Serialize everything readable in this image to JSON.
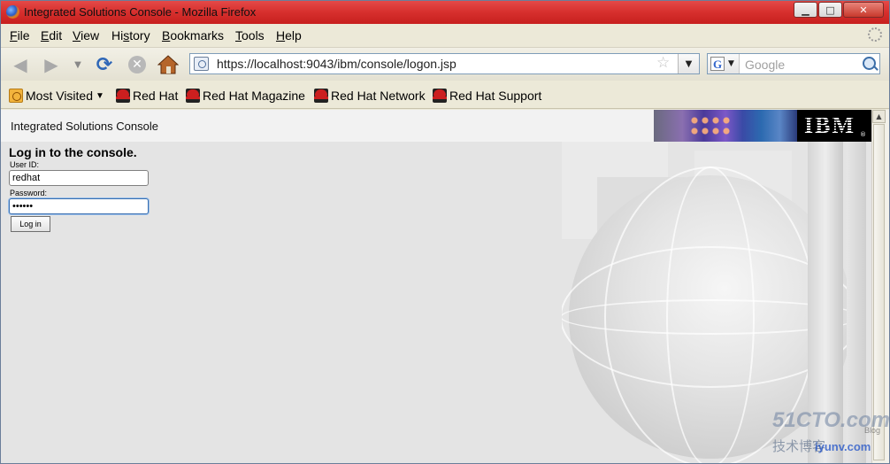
{
  "window": {
    "title": "Integrated Solutions Console - Mozilla Firefox",
    "controls": {
      "minimize": "▁",
      "maximize": "□",
      "close": "✕"
    }
  },
  "menu": [
    {
      "label": "File",
      "accel": "F",
      "rest": "ile"
    },
    {
      "label": "Edit",
      "accel": "E",
      "rest": "dit"
    },
    {
      "label": "View",
      "accel": "V",
      "rest": "iew"
    },
    {
      "label": "History",
      "accel": "",
      "pre": "Hi",
      "mid": "s",
      "rest": "tory"
    },
    {
      "label": "Bookmarks",
      "accel": "B",
      "rest": "ookmarks"
    },
    {
      "label": "Tools",
      "accel": "T",
      "rest": "ools"
    },
    {
      "label": "Help",
      "accel": "H",
      "rest": "elp"
    }
  ],
  "navigation": {
    "back_icon": "left-arrow-icon",
    "forward_icon": "right-arrow-icon",
    "reload_icon": "reload-icon",
    "stop_icon": "stop-icon",
    "home_icon": "home-icon",
    "url": "https://localhost:9043/ibm/console/logon.jsp",
    "search_placeholder": "Google",
    "search_engine_letter": "G"
  },
  "bookmarks": [
    {
      "label": "Most Visited",
      "icon": "folder-icon",
      "has_menu": true
    },
    {
      "label": "Red Hat",
      "icon": "redhat-icon"
    },
    {
      "label": "Red Hat Magazine",
      "icon": "redhat-icon"
    },
    {
      "label": "Red Hat Network",
      "icon": "redhat-icon"
    },
    {
      "label": "Red Hat Support",
      "icon": "redhat-icon"
    }
  ],
  "page": {
    "console_title": "Integrated Solutions Console",
    "brand": "IBM",
    "brand_mark": "®",
    "login": {
      "heading": "Log in to the console.",
      "user_id_label": "User ID:",
      "user_id_value": "redhat",
      "password_label": "Password:",
      "password_value": "••••••",
      "login_button": "Log in"
    }
  },
  "watermark": {
    "line1": "51CTO.com",
    "line2": "技术博客",
    "line3": "iyunv.com",
    "line4": "Blog"
  }
}
